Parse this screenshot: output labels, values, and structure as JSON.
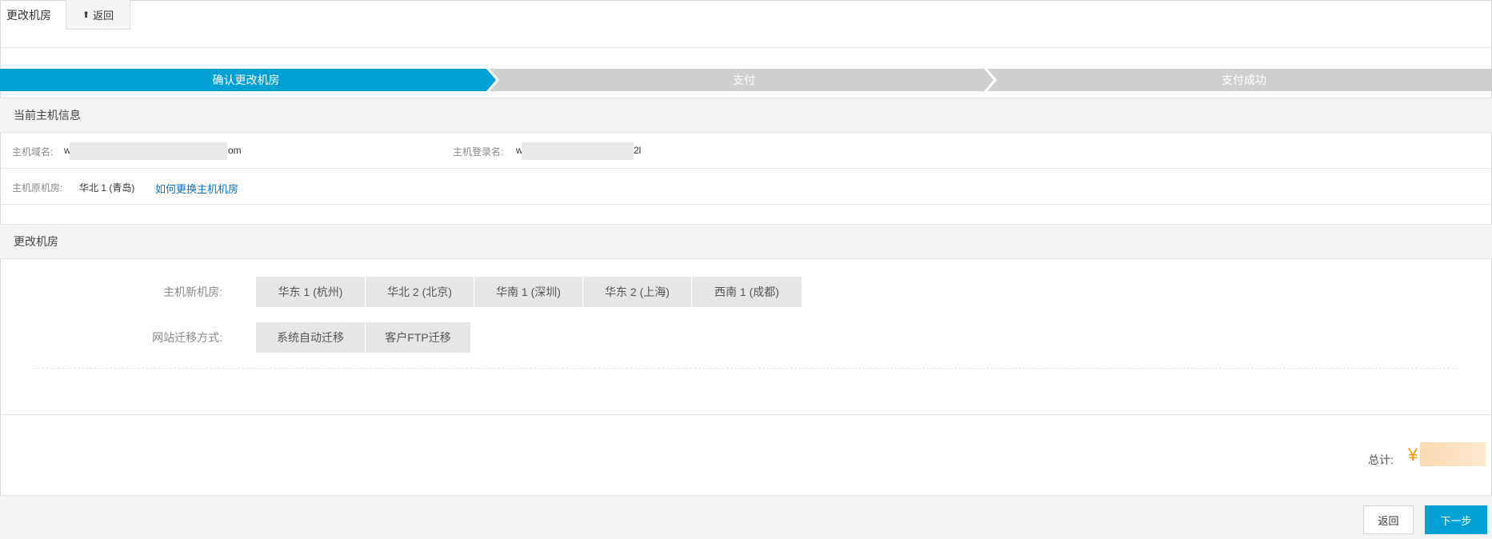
{
  "header": {
    "title": "更改机房",
    "back_label": "返回",
    "back_icon": "up-arrow-icon"
  },
  "steps": [
    {
      "label": "确认更改机房",
      "state": "active"
    },
    {
      "label": "支付",
      "state": "pending"
    },
    {
      "label": "支付成功",
      "state": "pending"
    }
  ],
  "colors": {
    "active_step": "#00a2d6",
    "pending_step": "#cfcfcf",
    "primary_button": "#00a2d6",
    "price": "#f39800",
    "link": "#0a6fc2"
  },
  "current_host": {
    "section_title": "当前主机信息",
    "domain_label": "主机域名:",
    "domain_value_start": "w",
    "domain_value_end": "om",
    "login_label": "主机登录名:",
    "login_value_start": "w",
    "login_value_end": "2l",
    "room_label": "主机原机房:",
    "room_value": "华北 1 (青岛)",
    "help_link": "如何更换主机机房"
  },
  "change_room": {
    "section_title": "更改机房",
    "new_room_label": "主机新机房:",
    "rooms": [
      "华东 1 (杭州)",
      "华北 2 (北京)",
      "华南 1 (深圳)",
      "华东 2 (上海)",
      "西南 1 (成都)"
    ],
    "migration_label": "网站迁移方式:",
    "migration_options": [
      "系统自动迁移",
      "客户FTP迁移"
    ]
  },
  "total": {
    "label": "总计:",
    "currency": "¥"
  },
  "footer": {
    "back_label": "返回",
    "next_label": "下一步"
  }
}
